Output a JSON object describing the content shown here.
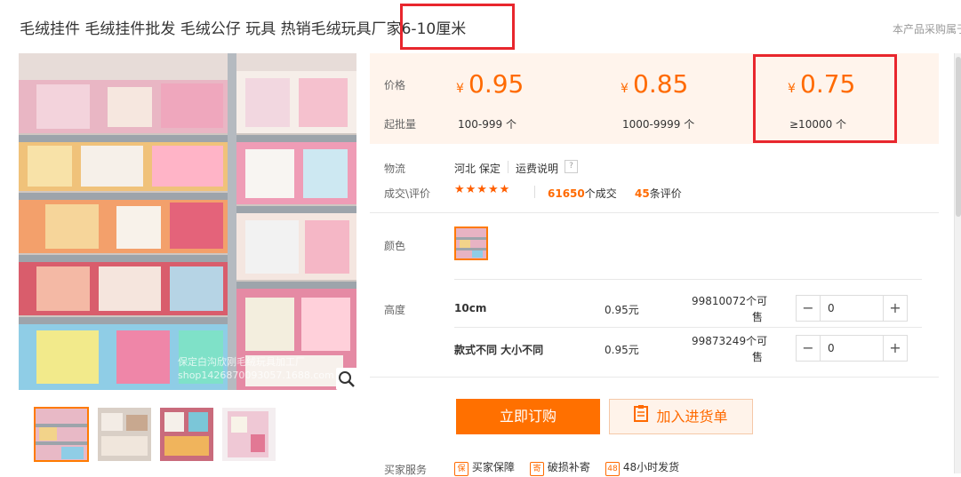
{
  "title": "毛绒挂件 毛绒挂件批发 毛绒公仔 玩具 热销毛绒玩具厂家6-10厘米",
  "title_highlight": "家6-10厘米",
  "purchase_note": "本产品采购属于",
  "watermark": {
    "line1": "保定白沟欣刚毛绒玩具加工厂",
    "line2": "shop1426870093057.1688.com"
  },
  "price_panel": {
    "price_label": "价格",
    "moq_label": "起批量",
    "currency": "¥",
    "tiers": [
      {
        "price": "0.95",
        "range": "100-999 个"
      },
      {
        "price": "0.85",
        "range": "1000-9999 个"
      },
      {
        "price": "0.75",
        "range": "≥10000 个"
      }
    ]
  },
  "logistics": {
    "label": "物流",
    "origin": "河北 保定",
    "freight_link": "运费说明",
    "help": "?"
  },
  "deals": {
    "label": "成交\\评价",
    "stars": "★★★★★",
    "rating": 4.5,
    "deals_count": "61650",
    "deals_suffix": "个成交",
    "reviews_count": "45",
    "reviews_suffix": "条评价"
  },
  "color": {
    "label": "颜色"
  },
  "height": {
    "label": "高度",
    "rows": [
      {
        "name": "10cm",
        "price": "0.95元",
        "stock_line1": "99810072个可",
        "stock_line2": "售",
        "qty": "0"
      },
      {
        "name": "款式不同 大小不同",
        "price": "0.95元",
        "stock_line1": "99873249个可",
        "stock_line2": "售",
        "qty": "0"
      }
    ]
  },
  "stepper": {
    "minus": "−",
    "plus": "+"
  },
  "actions": {
    "buy_now": "立即订购",
    "add_to_list": "加入进货单"
  },
  "services": {
    "label": "买家服务",
    "items": [
      {
        "icon": "shield-icon",
        "glyph": "保",
        "text": "买家保障"
      },
      {
        "icon": "package-icon",
        "glyph": "寄",
        "text": "破损补寄"
      },
      {
        "icon": "clock-48-icon",
        "glyph": "48",
        "text": "48小时发货"
      }
    ]
  },
  "colors": {
    "accent": "#ff6a00",
    "highlight_box": "#e8262d",
    "price_bg": "#fff4ec"
  }
}
